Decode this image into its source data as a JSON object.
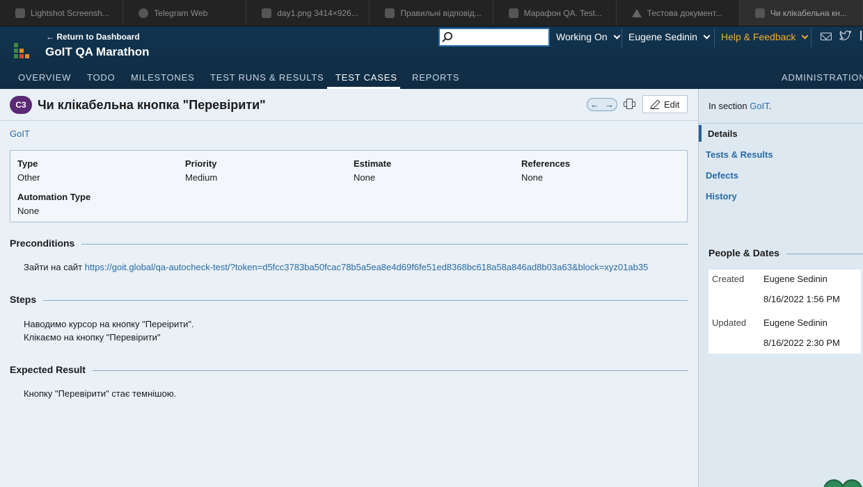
{
  "browser_tabs": [
    {
      "title": "Lightshot Screensh...",
      "icon": "lightshot-icon"
    },
    {
      "title": "Telegram Web",
      "icon": "telegram-icon"
    },
    {
      "title": "day1.png 3414×926...",
      "icon": "image-icon"
    },
    {
      "title": "Правильні відповід...",
      "icon": "doc-icon"
    },
    {
      "title": "Марафон QA. Test...",
      "icon": "testrail-icon"
    },
    {
      "title": "Тестова документ...",
      "icon": "drive-icon"
    },
    {
      "title": "Чи клікабельна кн...",
      "icon": "testrail-icon",
      "active": true
    }
  ],
  "header": {
    "back_link": "← Return to Dashboard",
    "project_title": "GoIT QA Marathon",
    "search_placeholder": "",
    "working_on": "Working On",
    "user_menu": "Eugene Sedinin",
    "help_menu": "Help & Feedback",
    "help_color": "#f0b030"
  },
  "nav": {
    "tabs": [
      "OVERVIEW",
      "TODO",
      "MILESTONES",
      "TEST RUNS & RESULTS",
      "TEST CASES",
      "REPORTS"
    ],
    "active": "TEST CASES",
    "admin": "ADMINISTRATION"
  },
  "case": {
    "id_badge": "C3",
    "title": "Чи клікабельна кнопка \"Перевірити\"",
    "edit_label": "Edit",
    "section_link": "GoIT",
    "fields": {
      "type_label": "Type",
      "type_value": "Other",
      "priority_label": "Priority",
      "priority_value": "Medium",
      "estimate_label": "Estimate",
      "estimate_value": "None",
      "references_label": "References",
      "references_value": "None",
      "automation_label": "Automation Type",
      "automation_value": "None"
    },
    "preconditions_heading": "Preconditions",
    "preconditions_text": "Зайти на сайт ",
    "preconditions_link": "https://goit.global/qa-autocheck-test/?token=d5fcc3783ba50fcac78b5a5ea8e4d69f6fe51ed8368bc618a58a846ad8b03a63&block=xyz01ab35",
    "steps_heading": "Steps",
    "steps": [
      "Наводимо курсор на кнопку \"Переірити\".",
      "Клікаємо на кнопку \"Перевірити\""
    ],
    "expected_heading": "Expected Result",
    "expected": "Кнопку \"Перевірити\" стає темнішою."
  },
  "sidebar": {
    "in_section_prefix": "In section ",
    "in_section_link": "GoIT",
    "in_section_suffix": ".",
    "nav": [
      "Details",
      "Tests & Results",
      "Defects",
      "History"
    ],
    "active_nav": "Details",
    "people_heading": "People & Dates",
    "created_label": "Created",
    "created_by": "Eugene Sedinin",
    "created_at": "8/16/2022 1:56 PM",
    "updated_label": "Updated",
    "updated_by": "Eugene Sedinin",
    "updated_at": "8/16/2022 2:30 PM"
  },
  "colors": {
    "header_bg": "#12344f",
    "badge_bg": "#5b2a74",
    "link": "#2a6aa6",
    "page_bg": "#e9f0f6"
  }
}
